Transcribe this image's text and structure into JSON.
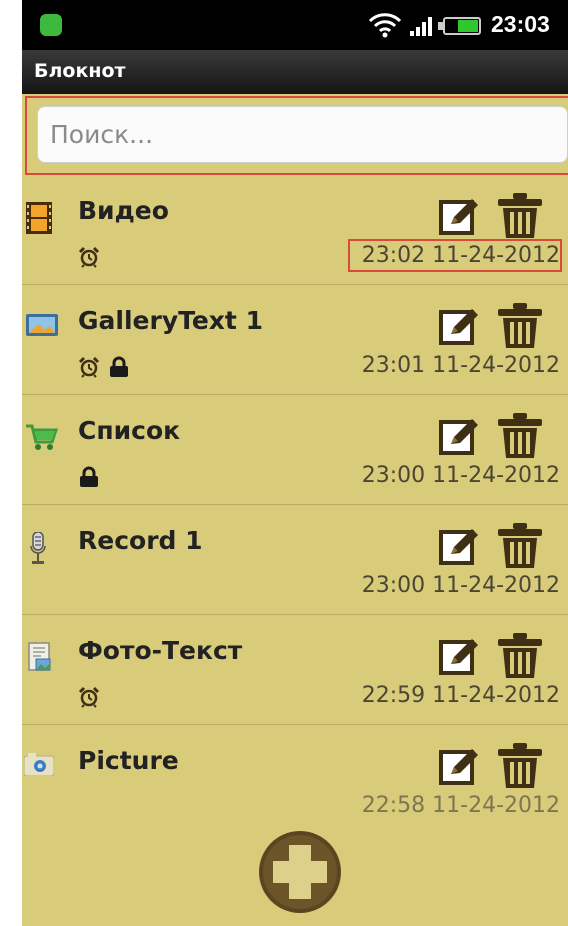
{
  "status_bar": {
    "time": "23:03"
  },
  "app": {
    "title": "Блокнот"
  },
  "search": {
    "placeholder": "Поиск..."
  },
  "notes": [
    {
      "title": "Видео",
      "date": "23:02 11-24-2012",
      "type_icon": "video-film-icon",
      "badges": [
        "alarm-clock-icon"
      ]
    },
    {
      "title": "GalleryText 1",
      "date": "23:01 11-24-2012",
      "type_icon": "gallery-image-icon",
      "badges": [
        "alarm-clock-icon",
        "lock-icon"
      ]
    },
    {
      "title": "Список",
      "date": "23:00 11-24-2012",
      "type_icon": "shopping-cart-icon",
      "badges": [
        "lock-icon"
      ]
    },
    {
      "title": "Record 1",
      "date": "23:00 11-24-2012",
      "type_icon": "microphone-icon",
      "badges": []
    },
    {
      "title": "Фото-Текст",
      "date": "22:59 11-24-2012",
      "type_icon": "photo-text-icon",
      "badges": [
        "alarm-clock-icon"
      ]
    },
    {
      "title": "Picture",
      "date": "22:58 11-24-2012",
      "type_icon": "camera-icon",
      "badges": []
    }
  ],
  "colors": {
    "background": "#d8cb7a",
    "icon_brown": "#5a4520",
    "highlight_red": "#d9493c",
    "status_bar": "#000000"
  }
}
